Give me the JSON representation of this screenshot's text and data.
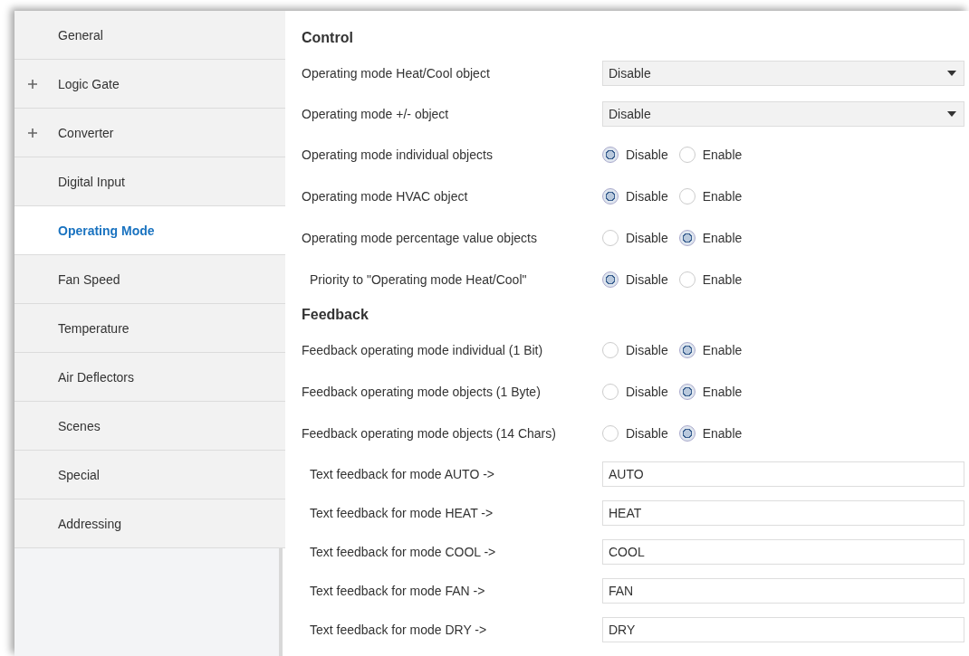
{
  "sidebar": {
    "items": [
      {
        "label": "General",
        "expandable": false,
        "selected": false
      },
      {
        "label": "Logic Gate",
        "expandable": true,
        "selected": false
      },
      {
        "label": "Converter",
        "expandable": true,
        "selected": false
      },
      {
        "label": "Digital Input",
        "expandable": false,
        "selected": false
      },
      {
        "label": "Operating Mode",
        "expandable": false,
        "selected": true
      },
      {
        "label": "Fan Speed",
        "expandable": false,
        "selected": false
      },
      {
        "label": "Temperature",
        "expandable": false,
        "selected": false
      },
      {
        "label": "Air Deflectors",
        "expandable": false,
        "selected": false
      },
      {
        "label": "Scenes",
        "expandable": false,
        "selected": false
      },
      {
        "label": "Special",
        "expandable": false,
        "selected": false
      },
      {
        "label": "Addressing",
        "expandable": false,
        "selected": false
      }
    ]
  },
  "sections": [
    {
      "title": "Control",
      "rows": [
        {
          "kind": "dropdown",
          "label": "Operating mode Heat/Cool object",
          "indent": false,
          "value": "Disable"
        },
        {
          "kind": "dropdown",
          "label": "Operating mode +/- object",
          "indent": false,
          "value": "Disable"
        },
        {
          "kind": "radio",
          "label": "Operating mode individual objects",
          "indent": false,
          "options": [
            {
              "label": "Disable",
              "selected": true
            },
            {
              "label": "Enable",
              "selected": false
            }
          ]
        },
        {
          "kind": "radio",
          "label": "Operating mode HVAC object",
          "indent": false,
          "options": [
            {
              "label": "Disable",
              "selected": true
            },
            {
              "label": "Enable",
              "selected": false
            }
          ]
        },
        {
          "kind": "radio",
          "label": "Operating mode percentage value objects",
          "indent": false,
          "options": [
            {
              "label": "Disable",
              "selected": false
            },
            {
              "label": "Enable",
              "selected": true
            }
          ]
        },
        {
          "kind": "radio",
          "label": "Priority to \"Operating mode Heat/Cool\"",
          "indent": true,
          "options": [
            {
              "label": "Disable",
              "selected": true
            },
            {
              "label": "Enable",
              "selected": false
            }
          ]
        }
      ]
    },
    {
      "title": "Feedback",
      "rows": [
        {
          "kind": "radio",
          "label": "Feedback operating mode individual (1 Bit)",
          "indent": false,
          "options": [
            {
              "label": "Disable",
              "selected": false
            },
            {
              "label": "Enable",
              "selected": true
            }
          ]
        },
        {
          "kind": "radio",
          "label": "Feedback operating mode objects (1 Byte)",
          "indent": false,
          "options": [
            {
              "label": "Disable",
              "selected": false
            },
            {
              "label": "Enable",
              "selected": true
            }
          ]
        },
        {
          "kind": "radio",
          "label": "Feedback operating mode objects (14 Chars)",
          "indent": false,
          "options": [
            {
              "label": "Disable",
              "selected": false
            },
            {
              "label": "Enable",
              "selected": true
            }
          ]
        },
        {
          "kind": "text",
          "label": "Text feedback for mode AUTO ->",
          "indent": true,
          "value": "AUTO"
        },
        {
          "kind": "text",
          "label": "Text feedback for mode HEAT ->",
          "indent": true,
          "value": "HEAT"
        },
        {
          "kind": "text",
          "label": "Text feedback for mode COOL ->",
          "indent": true,
          "value": "COOL"
        },
        {
          "kind": "text",
          "label": "Text feedback for mode FAN ->",
          "indent": true,
          "value": "FAN"
        },
        {
          "kind": "text",
          "label": "Text feedback for mode DRY ->",
          "indent": true,
          "value": "DRY"
        }
      ]
    }
  ]
}
